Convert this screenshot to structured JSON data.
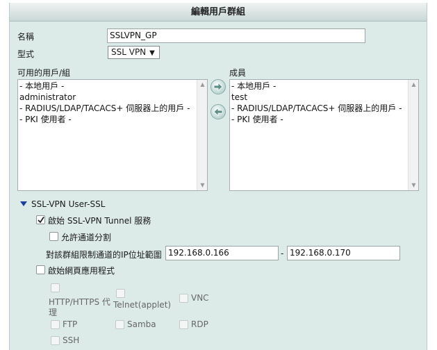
{
  "dialog": {
    "title": "編輯用戶群組"
  },
  "form": {
    "name_label": "名稱",
    "name_value": "SSLVPN_GP",
    "type_label": "型式",
    "type_value": "SSL VPN",
    "type_caret": "▼"
  },
  "available": {
    "label": "可用的用戶/組",
    "items": [
      "- 本地用戶 -",
      "administrator",
      "- RADIUS/LDAP/TACACS+ 伺服器上的用戶 -",
      "- PKI 使用者 -"
    ]
  },
  "members": {
    "label": "成員",
    "items": [
      "- 本地用戶 -",
      "test",
      "- RADIUS/LDAP/TACACS+ 伺服器上的用戶 -",
      "- PKI 使用者 -"
    ]
  },
  "ssl": {
    "section_title": "SSL-VPN User-SSL",
    "tunnel_label": "啟始 SSL-VPN Tunnel 服務",
    "tunnel_checked": true,
    "split_label": "允許通道分割",
    "split_checked": false,
    "ip_range_label": "對該群組限制通道的IP位址範圍",
    "ip_start": "192.168.0.166",
    "ip_separator": "-",
    "ip_end": "192.168.0.170",
    "webapp_label": "啟始網頁應用程式",
    "webapp_checked": false,
    "apps": {
      "http_line1": "HTTP/HTTPS 代",
      "http_line2": "理",
      "telnet": "Telnet(applet)",
      "vnc": "VNC",
      "ftp": "FTP",
      "samba": "Samba",
      "rdp": "RDP",
      "ssh": "SSH"
    }
  },
  "colors": {
    "panel": "#dceae8",
    "section_triangle": "#1a3f9e",
    "arrow_fill": "#5f8f86"
  }
}
